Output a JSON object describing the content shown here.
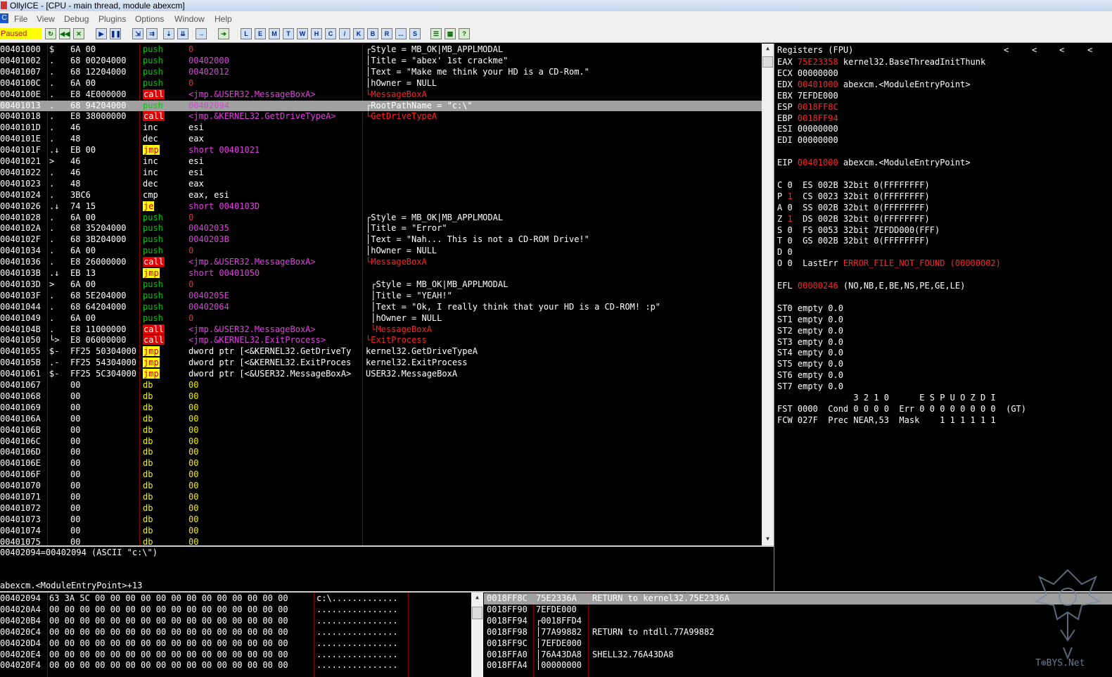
{
  "window": {
    "title": "OllyICE - [CPU - main thread, module abexcm]"
  },
  "menu": [
    "File",
    "View",
    "Debug",
    "Plugins",
    "Options",
    "Window",
    "Help"
  ],
  "toolbar": {
    "status": "Paused",
    "debug_buttons": [
      "open-icon",
      "rewind-icon",
      "close-icon",
      "run-icon",
      "pause-icon",
      "step-into-icon",
      "step-over-icon",
      "trace-into-icon",
      "trace-over-icon",
      "execute-till-return-icon",
      "goto-icon"
    ],
    "window_buttons": [
      "L",
      "E",
      "M",
      "T",
      "W",
      "H",
      "C",
      "/",
      "K",
      "B",
      "R",
      "...",
      "S"
    ],
    "extra_buttons": [
      "list-icon",
      "grid-icon",
      "help-icon"
    ]
  },
  "disasm": [
    {
      "addr": "00401000",
      "mk": "$",
      "hex": "6A 00",
      "mn": "push",
      "op": "0",
      "cm": "┌Style = MB_OK|MB_APPLMODAL",
      "mtype": "push",
      "otype": "red",
      "ctype": "white"
    },
    {
      "addr": "00401002",
      "mk": ".",
      "hex": "68 00204000",
      "mn": "push",
      "op": "00402000",
      "cm": "│Title = \"abex' 1st crackme\"",
      "mtype": "push",
      "otype": "mg",
      "ctype": "white"
    },
    {
      "addr": "00401007",
      "mk": ".",
      "hex": "68 12204000",
      "mn": "push",
      "op": "00402012",
      "cm": "│Text = \"Make me think your HD is a CD-Rom.\"",
      "mtype": "push",
      "otype": "mg",
      "ctype": "white"
    },
    {
      "addr": "0040100C",
      "mk": ".",
      "hex": "6A 00",
      "mn": "push",
      "op": "0",
      "cm": "│hOwner = NULL",
      "mtype": "push",
      "otype": "red",
      "ctype": "white"
    },
    {
      "addr": "0040100E",
      "mk": ".",
      "hex": "E8 4E000000",
      "mn": "call",
      "op": "<jmp.&USER32.MessageBoxA>",
      "cm": "└MessageBoxA",
      "mtype": "call",
      "otype": "mg",
      "ctype": "red"
    },
    {
      "addr": "00401013",
      "mk": ".",
      "hex": "68 94204000",
      "mn": "push",
      "op": "00402094",
      "cm": "┌RootPathName = \"c:\\\"",
      "mtype": "push",
      "otype": "mg",
      "ctype": "white",
      "sel": true
    },
    {
      "addr": "00401018",
      "mk": ".",
      "hex": "E8 38000000",
      "mn": "call",
      "op": "<jmp.&KERNEL32.GetDriveTypeA>",
      "cm": "└GetDriveTypeA",
      "mtype": "call",
      "otype": "mg",
      "ctype": "red"
    },
    {
      "addr": "0040101D",
      "mk": ".",
      "hex": "46",
      "mn": "inc",
      "op": "esi",
      "cm": "",
      "mtype": "w",
      "otype": "w",
      "ctype": "white"
    },
    {
      "addr": "0040101E",
      "mk": ".",
      "hex": "48",
      "mn": "dec",
      "op": "eax",
      "cm": "",
      "mtype": "w",
      "otype": "w",
      "ctype": "white"
    },
    {
      "addr": "0040101F",
      "mk": ".↓",
      "hex": "EB 00",
      "mn": "jmp",
      "op": "short 00401021",
      "cm": "",
      "mtype": "jmp",
      "otype": "mg",
      "ctype": "white"
    },
    {
      "addr": "00401021",
      "mk": ">",
      "hex": "46",
      "mn": "inc",
      "op": "esi",
      "cm": "",
      "mtype": "w",
      "otype": "w",
      "ctype": "white"
    },
    {
      "addr": "00401022",
      "mk": ".",
      "hex": "46",
      "mn": "inc",
      "op": "esi",
      "cm": "",
      "mtype": "w",
      "otype": "w",
      "ctype": "white"
    },
    {
      "addr": "00401023",
      "mk": ".",
      "hex": "48",
      "mn": "dec",
      "op": "eax",
      "cm": "",
      "mtype": "w",
      "otype": "w",
      "ctype": "white"
    },
    {
      "addr": "00401024",
      "mk": ".",
      "hex": "3BC6",
      "mn": "cmp",
      "op": "eax, esi",
      "cm": "",
      "mtype": "w",
      "otype": "w",
      "ctype": "white"
    },
    {
      "addr": "00401026",
      "mk": ".↓",
      "hex": "74 15",
      "mn": "je",
      "op": "short 0040103D",
      "cm": "",
      "mtype": "jmp",
      "otype": "mg",
      "ctype": "white"
    },
    {
      "addr": "00401028",
      "mk": ".",
      "hex": "6A 00",
      "mn": "push",
      "op": "0",
      "cm": "┌Style = MB_OK|MB_APPLMODAL",
      "mtype": "push",
      "otype": "red",
      "ctype": "white"
    },
    {
      "addr": "0040102A",
      "mk": ".",
      "hex": "68 35204000",
      "mn": "push",
      "op": "00402035",
      "cm": "│Title = \"Error\"",
      "mtype": "push",
      "otype": "mg",
      "ctype": "white"
    },
    {
      "addr": "0040102F",
      "mk": ".",
      "hex": "68 3B204000",
      "mn": "push",
      "op": "0040203B",
      "cm": "│Text = \"Nah... This is not a CD-ROM Drive!\"",
      "mtype": "push",
      "otype": "mg",
      "ctype": "white"
    },
    {
      "addr": "00401034",
      "mk": ".",
      "hex": "6A 00",
      "mn": "push",
      "op": "0",
      "cm": "│hOwner = NULL",
      "mtype": "push",
      "otype": "red",
      "ctype": "white"
    },
    {
      "addr": "00401036",
      "mk": ".",
      "hex": "E8 26000000",
      "mn": "call",
      "op": "<jmp.&USER32.MessageBoxA>",
      "cm": "└MessageBoxA",
      "mtype": "call",
      "otype": "mg",
      "ctype": "red"
    },
    {
      "addr": "0040103B",
      "mk": ".↓",
      "hex": "EB 13",
      "mn": "jmp",
      "op": "short 00401050",
      "cm": "",
      "mtype": "jmp",
      "otype": "mg",
      "ctype": "white"
    },
    {
      "addr": "0040103D",
      "mk": ">",
      "hex": "6A 00",
      "mn": "push",
      "op": "0",
      "cm": " ┌Style = MB_OK|MB_APPLMODAL",
      "mtype": "push",
      "otype": "red",
      "ctype": "white"
    },
    {
      "addr": "0040103F",
      "mk": ".",
      "hex": "68 5E204000",
      "mn": "push",
      "op": "0040205E",
      "cm": " │Title = \"YEAH!\"",
      "mtype": "push",
      "otype": "mg",
      "ctype": "white"
    },
    {
      "addr": "00401044",
      "mk": ".",
      "hex": "68 64204000",
      "mn": "push",
      "op": "00402064",
      "cm": " │Text = \"Ok, I really think that your HD is a CD-ROM! :p\"",
      "mtype": "push",
      "otype": "mg",
      "ctype": "white"
    },
    {
      "addr": "00401049",
      "mk": ".",
      "hex": "6A 00",
      "mn": "push",
      "op": "0",
      "cm": " │hOwner = NULL",
      "mtype": "push",
      "otype": "red",
      "ctype": "white"
    },
    {
      "addr": "0040104B",
      "mk": ".",
      "hex": "E8 11000000",
      "mn": "call",
      "op": "<jmp.&USER32.MessageBoxA>",
      "cm": " └MessageBoxA",
      "mtype": "call",
      "otype": "mg",
      "ctype": "red"
    },
    {
      "addr": "00401050",
      "mk": "└>",
      "hex": "E8 06000000",
      "mn": "call",
      "op": "<jmp.&KERNEL32.ExitProcess>",
      "cm": "└ExitProcess",
      "mtype": "call",
      "otype": "mg",
      "ctype": "red"
    },
    {
      "addr": "00401055",
      "mk": "$-",
      "hex": "FF25 50304000",
      "mn": "jmp",
      "op": "dword ptr [<&KERNEL32.GetDriveTy",
      "cm": "kernel32.GetDriveTypeA",
      "mtype": "jmp",
      "otype": "w",
      "ctype": "white"
    },
    {
      "addr": "0040105B",
      "mk": ".-",
      "hex": "FF25 54304000",
      "mn": "jmp",
      "op": "dword ptr [<&KERNEL32.ExitProces",
      "cm": "kernel32.ExitProcess",
      "mtype": "jmp",
      "otype": "w",
      "ctype": "white"
    },
    {
      "addr": "00401061",
      "mk": "$-",
      "hex": "FF25 5C304000",
      "mn": "jmp",
      "op": "dword ptr [<&USER32.MessageBoxA>",
      "cm": "USER32.MessageBoxA",
      "mtype": "jmp",
      "otype": "w",
      "ctype": "white"
    },
    {
      "addr": "00401067",
      "mk": "",
      "hex": "00",
      "mn": "db",
      "op": "00",
      "cm": "",
      "mtype": "db",
      "otype": "db",
      "ctype": "white"
    },
    {
      "addr": "00401068",
      "mk": "",
      "hex": "00",
      "mn": "db",
      "op": "00",
      "cm": "",
      "mtype": "db",
      "otype": "db",
      "ctype": "white"
    },
    {
      "addr": "00401069",
      "mk": "",
      "hex": "00",
      "mn": "db",
      "op": "00",
      "cm": "",
      "mtype": "db",
      "otype": "db",
      "ctype": "white"
    },
    {
      "addr": "0040106A",
      "mk": "",
      "hex": "00",
      "mn": "db",
      "op": "00",
      "cm": "",
      "mtype": "db",
      "otype": "db",
      "ctype": "white"
    },
    {
      "addr": "0040106B",
      "mk": "",
      "hex": "00",
      "mn": "db",
      "op": "00",
      "cm": "",
      "mtype": "db",
      "otype": "db",
      "ctype": "white"
    },
    {
      "addr": "0040106C",
      "mk": "",
      "hex": "00",
      "mn": "db",
      "op": "00",
      "cm": "",
      "mtype": "db",
      "otype": "db",
      "ctype": "white"
    },
    {
      "addr": "0040106D",
      "mk": "",
      "hex": "00",
      "mn": "db",
      "op": "00",
      "cm": "",
      "mtype": "db",
      "otype": "db",
      "ctype": "white"
    },
    {
      "addr": "0040106E",
      "mk": "",
      "hex": "00",
      "mn": "db",
      "op": "00",
      "cm": "",
      "mtype": "db",
      "otype": "db",
      "ctype": "white"
    },
    {
      "addr": "0040106F",
      "mk": "",
      "hex": "00",
      "mn": "db",
      "op": "00",
      "cm": "",
      "mtype": "db",
      "otype": "db",
      "ctype": "white"
    },
    {
      "addr": "00401070",
      "mk": "",
      "hex": "00",
      "mn": "db",
      "op": "00",
      "cm": "",
      "mtype": "db",
      "otype": "db",
      "ctype": "white"
    },
    {
      "addr": "00401071",
      "mk": "",
      "hex": "00",
      "mn": "db",
      "op": "00",
      "cm": "",
      "mtype": "db",
      "otype": "db",
      "ctype": "white"
    },
    {
      "addr": "00401072",
      "mk": "",
      "hex": "00",
      "mn": "db",
      "op": "00",
      "cm": "",
      "mtype": "db",
      "otype": "db",
      "ctype": "white"
    },
    {
      "addr": "00401073",
      "mk": "",
      "hex": "00",
      "mn": "db",
      "op": "00",
      "cm": "",
      "mtype": "db",
      "otype": "db",
      "ctype": "white"
    },
    {
      "addr": "00401074",
      "mk": "",
      "hex": "00",
      "mn": "db",
      "op": "00",
      "cm": "",
      "mtype": "db",
      "otype": "db",
      "ctype": "white"
    },
    {
      "addr": "00401075",
      "mk": "",
      "hex": "00",
      "mn": "db",
      "op": "00",
      "cm": "",
      "mtype": "db",
      "otype": "db",
      "ctype": "white"
    }
  ],
  "registers": {
    "header": "Registers (FPU)",
    "lines": [
      [
        {
          "t": "EAX ",
          "c": "w"
        },
        {
          "t": "75E23358",
          "c": "rd"
        },
        {
          "t": " kernel32.BaseThreadInitThunk",
          "c": "w"
        }
      ],
      [
        {
          "t": "ECX 00000000",
          "c": "w"
        }
      ],
      [
        {
          "t": "EDX ",
          "c": "w"
        },
        {
          "t": "00401000",
          "c": "rd"
        },
        {
          "t": " abexcm.<ModuleEntryPoint>",
          "c": "w"
        }
      ],
      [
        {
          "t": "EBX 7EFDE000",
          "c": "w"
        }
      ],
      [
        {
          "t": "ESP ",
          "c": "w"
        },
        {
          "t": "0018FF8C",
          "c": "rd"
        }
      ],
      [
        {
          "t": "EBP ",
          "c": "w"
        },
        {
          "t": "0018FF94",
          "c": "rd"
        }
      ],
      [
        {
          "t": "ESI 00000000",
          "c": "w"
        }
      ],
      [
        {
          "t": "EDI 00000000",
          "c": "w"
        }
      ],
      [
        {
          "t": "",
          "c": "w"
        }
      ],
      [
        {
          "t": "EIP ",
          "c": "w"
        },
        {
          "t": "00401000",
          "c": "rd"
        },
        {
          "t": " abexcm.<ModuleEntryPoint>",
          "c": "w"
        }
      ],
      [
        {
          "t": "",
          "c": "w"
        }
      ],
      [
        {
          "t": "C 0  ES 002B 32bit 0(FFFFFFFF)",
          "c": "w"
        }
      ],
      [
        {
          "t": "P ",
          "c": "w"
        },
        {
          "t": "1",
          "c": "rd"
        },
        {
          "t": "  CS 0023 32bit 0(FFFFFFFF)",
          "c": "w"
        }
      ],
      [
        {
          "t": "A 0  SS 002B 32bit 0(FFFFFFFF)",
          "c": "w"
        }
      ],
      [
        {
          "t": "Z ",
          "c": "w"
        },
        {
          "t": "1",
          "c": "rd"
        },
        {
          "t": "  DS 002B 32bit 0(FFFFFFFF)",
          "c": "w"
        }
      ],
      [
        {
          "t": "S 0  FS 0053 32bit 7EFDD000(FFF)",
          "c": "w"
        }
      ],
      [
        {
          "t": "T 0  GS 002B 32bit 0(FFFFFFFF)",
          "c": "w"
        }
      ],
      [
        {
          "t": "D 0",
          "c": "w"
        }
      ],
      [
        {
          "t": "O 0  LastErr ",
          "c": "w"
        },
        {
          "t": "ERROR_FILE_NOT_FOUND (00000002)",
          "c": "rd"
        }
      ],
      [
        {
          "t": "",
          "c": "w"
        }
      ],
      [
        {
          "t": "EFL ",
          "c": "w"
        },
        {
          "t": "00000246",
          "c": "rd"
        },
        {
          "t": " (NO,NB,E,BE,NS,PE,GE,LE)",
          "c": "w"
        }
      ],
      [
        {
          "t": "",
          "c": "w"
        }
      ],
      [
        {
          "t": "ST0 empty 0.0",
          "c": "w"
        }
      ],
      [
        {
          "t": "ST1 empty 0.0",
          "c": "w"
        }
      ],
      [
        {
          "t": "ST2 empty 0.0",
          "c": "w"
        }
      ],
      [
        {
          "t": "ST3 empty 0.0",
          "c": "w"
        }
      ],
      [
        {
          "t": "ST4 empty 0.0",
          "c": "w"
        }
      ],
      [
        {
          "t": "ST5 empty 0.0",
          "c": "w"
        }
      ],
      [
        {
          "t": "ST6 empty 0.0",
          "c": "w"
        }
      ],
      [
        {
          "t": "ST7 empty 0.0",
          "c": "w"
        }
      ],
      [
        {
          "t": "               3 2 1 0      E S P U O Z D I",
          "c": "w"
        }
      ],
      [
        {
          "t": "FST 0000  Cond 0 0 0 0  Err 0 0 0 0 0 0 0 0  (GT)",
          "c": "w"
        }
      ],
      [
        {
          "t": "FCW 027F  Prec NEAR,53  Mask    1 1 1 1 1 1",
          "c": "w"
        }
      ]
    ]
  },
  "info": {
    "line1": "00402094=00402094 (ASCII \"c:\\\")",
    "line2": "",
    "line3": "abexcm.<ModuleEntryPoint>+13"
  },
  "dump": [
    {
      "addr": "00402094",
      "hex": "63 3A 5C 00 00 00 00 00 00 00 00 00 00 00 00 00",
      "ascii": "c:\\............."
    },
    {
      "addr": "004020A4",
      "hex": "00 00 00 00 00 00 00 00 00 00 00 00 00 00 00 00",
      "ascii": "................"
    },
    {
      "addr": "004020B4",
      "hex": "00 00 00 00 00 00 00 00 00 00 00 00 00 00 00 00",
      "ascii": "................"
    },
    {
      "addr": "004020C4",
      "hex": "00 00 00 00 00 00 00 00 00 00 00 00 00 00 00 00",
      "ascii": "................"
    },
    {
      "addr": "004020D4",
      "hex": "00 00 00 00 00 00 00 00 00 00 00 00 00 00 00 00",
      "ascii": "................"
    },
    {
      "addr": "004020E4",
      "hex": "00 00 00 00 00 00 00 00 00 00 00 00 00 00 00 00",
      "ascii": "................"
    },
    {
      "addr": "004020F4",
      "hex": "00 00 00 00 00 00 00 00 00 00 00 00 00 00 00 00",
      "ascii": "................"
    }
  ],
  "stack": [
    {
      "addr": "0018FF8C",
      "val": "75E2336A",
      "cm": "RETURN to kernel32.75E2336A",
      "sel": true
    },
    {
      "addr": "0018FF90",
      "val": "7EFDE000",
      "cm": ""
    },
    {
      "addr": "0018FF94",
      "val": "┌0018FFD4",
      "cm": ""
    },
    {
      "addr": "0018FF98",
      "val": "│77A99882",
      "cm": "RETURN to ntdll.77A99882"
    },
    {
      "addr": "0018FF9C",
      "val": "│7EFDE000",
      "cm": ""
    },
    {
      "addr": "0018FFA0",
      "val": "│76A43DA8",
      "cm": "SHELL32.76A43DA8"
    },
    {
      "addr": "0018FFA4",
      "val": "│00000000",
      "cm": ""
    }
  ],
  "watermark": "T⊕BYS.Net",
  "colors": {
    "bg": "#000000",
    "push": "#00cc00",
    "call_bg": "#e00000",
    "jmp_bg": "#ffff00",
    "operand": "#e040e0",
    "highlight": "#ff2222"
  }
}
